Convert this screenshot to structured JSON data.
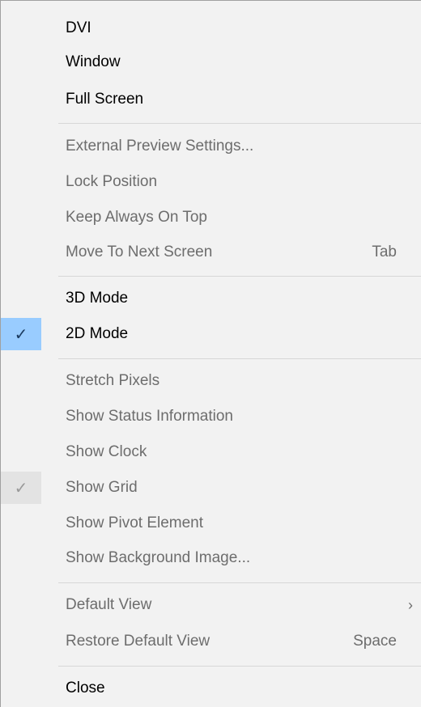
{
  "menu": {
    "items": [
      {
        "label": "DVI",
        "enabled": true
      },
      {
        "label": "Window",
        "enabled": true
      },
      {
        "label": "Full Screen",
        "enabled": true
      },
      {
        "label": "External Preview Settings...",
        "enabled": false
      },
      {
        "label": "Lock Position",
        "enabled": false
      },
      {
        "label": "Keep Always On Top",
        "enabled": false
      },
      {
        "label": "Move To Next Screen",
        "shortcut": "Tab",
        "enabled": false
      },
      {
        "label": "3D Mode",
        "enabled": true
      },
      {
        "label": "2D Mode",
        "enabled": true,
        "checked": true
      },
      {
        "label": "Stretch Pixels",
        "enabled": false
      },
      {
        "label": "Show Status Information",
        "enabled": false
      },
      {
        "label": "Show Clock",
        "enabled": false
      },
      {
        "label": "Show Grid",
        "enabled": false,
        "checked": true
      },
      {
        "label": "Show Pivot Element",
        "enabled": false
      },
      {
        "label": "Show Background Image...",
        "enabled": false
      },
      {
        "label": "Default View",
        "enabled": false,
        "submenu_arrow": "›"
      },
      {
        "label": "Restore Default View",
        "shortcut": "Space",
        "enabled": false
      },
      {
        "label": "Close",
        "enabled": true
      }
    ],
    "check_glyph": "✓",
    "colors": {
      "background": "#f2f2f2",
      "enabled_text": "#000000",
      "disabled_text": "#6d6d6d",
      "check_active_bg": "#99ccff",
      "check_inactive_bg": "#e3e3e3"
    }
  }
}
